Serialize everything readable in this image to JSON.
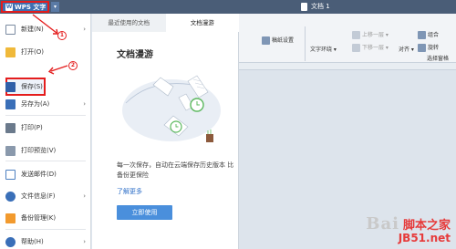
{
  "app": {
    "name": "WPS 文字",
    "menu_arrow": "▾"
  },
  "document": {
    "title": "文档 1"
  },
  "ribbon": {
    "items": [
      {
        "label": "稿纸设置"
      },
      {
        "label": "文字环绕"
      },
      {
        "label": "上移一层"
      },
      {
        "label": "下移一层"
      },
      {
        "label": "对齐"
      },
      {
        "label": "组合"
      },
      {
        "label": "旋转"
      },
      {
        "label": "选择窗格"
      }
    ]
  },
  "menu": {
    "items": [
      {
        "label": "新建(N)",
        "icon": "new-doc-icon",
        "has_submenu": true
      },
      {
        "label": "打开(O)",
        "icon": "folder-icon",
        "has_submenu": false
      },
      {
        "label": "保存(S)",
        "icon": "save-icon",
        "has_submenu": false
      },
      {
        "label": "另存为(A)",
        "icon": "save-as-icon",
        "has_submenu": true
      },
      {
        "label": "打印(P)",
        "icon": "print-icon",
        "has_submenu": false
      },
      {
        "label": "打印预览(V)",
        "icon": "print-preview-icon",
        "has_submenu": false
      },
      {
        "label": "发送邮件(D)",
        "icon": "mail-icon",
        "has_submenu": false
      },
      {
        "label": "文件信息(F)",
        "icon": "info-icon",
        "has_submenu": true
      },
      {
        "label": "备份管理(K)",
        "icon": "backup-icon",
        "has_submenu": false
      },
      {
        "label": "帮助(H)",
        "icon": "help-icon",
        "has_submenu": true
      }
    ]
  },
  "panel": {
    "tabs": [
      {
        "label": "最近使用的文档",
        "active": false
      },
      {
        "label": "文档漫游",
        "active": true
      }
    ],
    "title": "文档漫游",
    "description": "每一次保存，自动在云端保存历史版本 比备份更保险",
    "learn_more": "了解更多",
    "button": "立即使用"
  },
  "annotations": {
    "step1": "1",
    "step2": "2"
  },
  "watermark": {
    "main": "Bai",
    "sub1": "脚本之家",
    "sub2": "JB51.net"
  },
  "colors": {
    "highlight": "#e41d1d",
    "accent": "#4a8fdc",
    "titlebar": "#4a5d77"
  }
}
